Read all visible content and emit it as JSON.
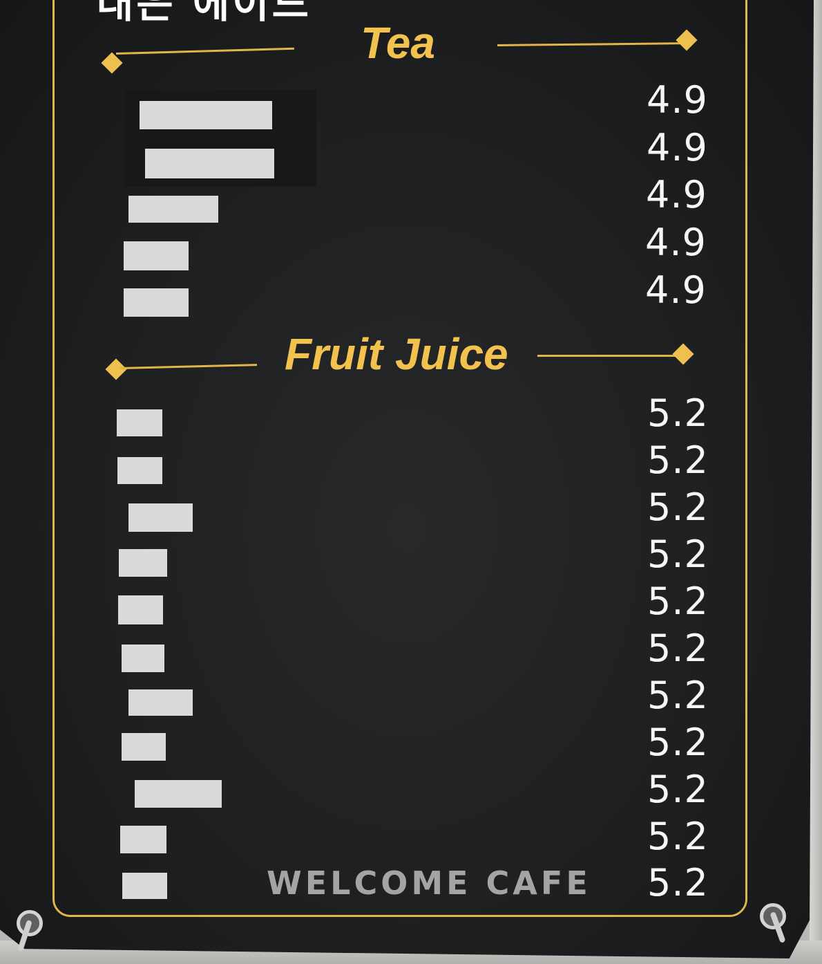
{
  "top_text": "대은 에이드",
  "sections": [
    {
      "title": "Tea",
      "prices": [
        "4.9",
        "4.9",
        "4.9",
        "4.9",
        "4.9"
      ]
    },
    {
      "title": "Fruit Juice",
      "prices": [
        "5.2",
        "5.2",
        "5.2",
        "5.2",
        "5.2",
        "5.2",
        "5.2",
        "5.2",
        "5.2",
        "5.2",
        "5.2"
      ]
    }
  ],
  "footer": "WELCOME CAFE",
  "colors": {
    "board": "#1d1f21",
    "gold": "#e2b548",
    "title": "#f2c24e",
    "price": "#f5f6f7",
    "redaction": "#d9dadc"
  }
}
